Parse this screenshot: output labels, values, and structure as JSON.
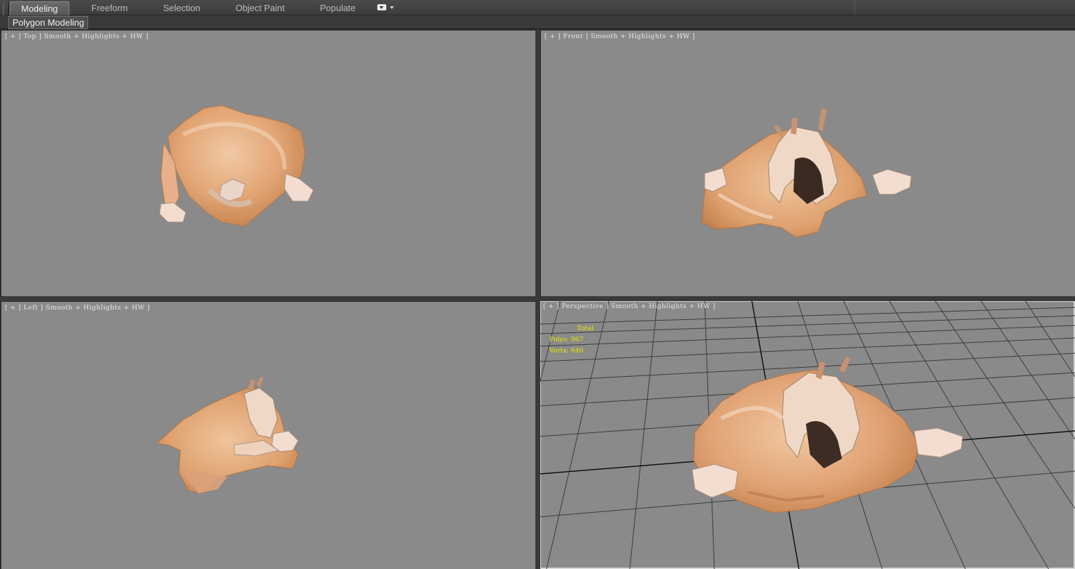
{
  "ribbon": {
    "tabs": [
      {
        "label": "Modeling",
        "active": true
      },
      {
        "label": "Freeform",
        "active": false
      },
      {
        "label": "Selection",
        "active": false
      },
      {
        "label": "Object Paint",
        "active": false
      },
      {
        "label": "Populate",
        "active": false
      }
    ],
    "options_icon": "ribbon-options-icon",
    "panel_tab": "Polygon Modeling"
  },
  "viewports": [
    {
      "id": "top",
      "label": "[ + ] Top ] Smooth + Highlights + HW ]"
    },
    {
      "id": "front",
      "label": "[ + ] Front ] Smooth + Highlights + HW ]"
    },
    {
      "id": "left",
      "label": "[ + ] Left ] Smooth + Highlights + HW ]"
    },
    {
      "id": "perspective",
      "label": "[ + ] Perspective ] Smooth + Highlights + HW ]"
    }
  ],
  "stats": {
    "header": "Total",
    "polys_label": "Polys:",
    "polys": "967",
    "verts_label": "Verts:",
    "verts": "640"
  },
  "colors": {
    "viewport_bg": "#8a8a8a",
    "stats_text": "#e8e800",
    "model_skin": "#e0a070",
    "model_light": "#f2d2bc"
  }
}
